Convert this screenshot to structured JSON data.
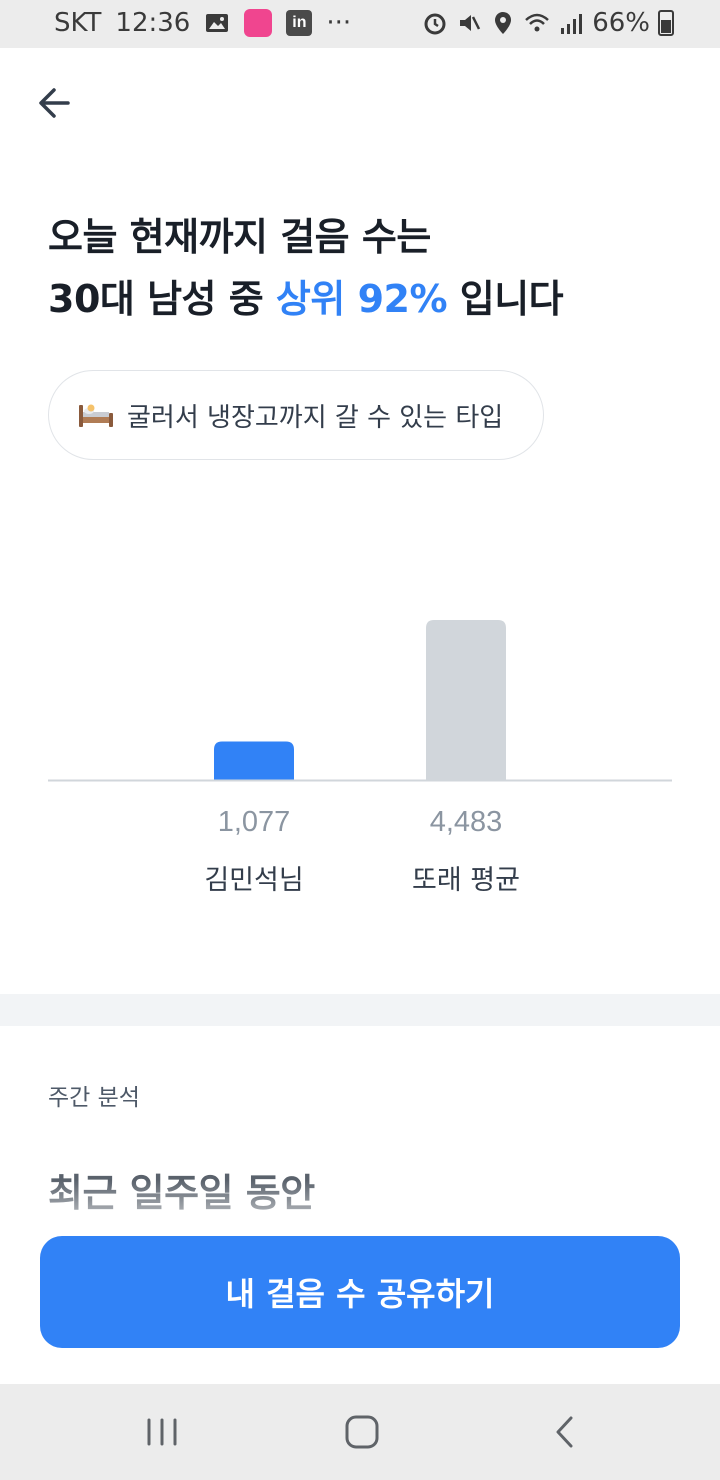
{
  "status_bar": {
    "carrier": "SKT",
    "time": "12:36",
    "dots": "···",
    "battery_percent": "66%"
  },
  "header": {
    "back_icon": "arrow-left-icon"
  },
  "headline": {
    "line1": "오늘 현재까지 걸음 수는",
    "line2_prefix": "30대 남성 중 ",
    "line2_accent": "상위 92%",
    "line2_suffix": " 입니다",
    "accent_color": "#3182f6"
  },
  "type_chip": {
    "icon": "bed-icon",
    "label": "굴러서 냉장고까지 갈 수 있는 타입"
  },
  "chart_data": {
    "type": "bar",
    "categories": [
      "김민석님",
      "또래 평균"
    ],
    "values": [
      1077,
      4483
    ],
    "value_labels": [
      "1,077",
      "4,483"
    ],
    "colors": [
      "#3182f6",
      "#d1d6db"
    ]
  },
  "weekly": {
    "section_label": "주간 분석",
    "title": "최근 일주일 동안"
  },
  "share_button": {
    "label": "내 걸음 수 공유하기",
    "color": "#3182f6"
  },
  "nav": {
    "recent_icon": "recent-apps-icon",
    "home_icon": "home-icon",
    "back_icon": "back-icon"
  }
}
